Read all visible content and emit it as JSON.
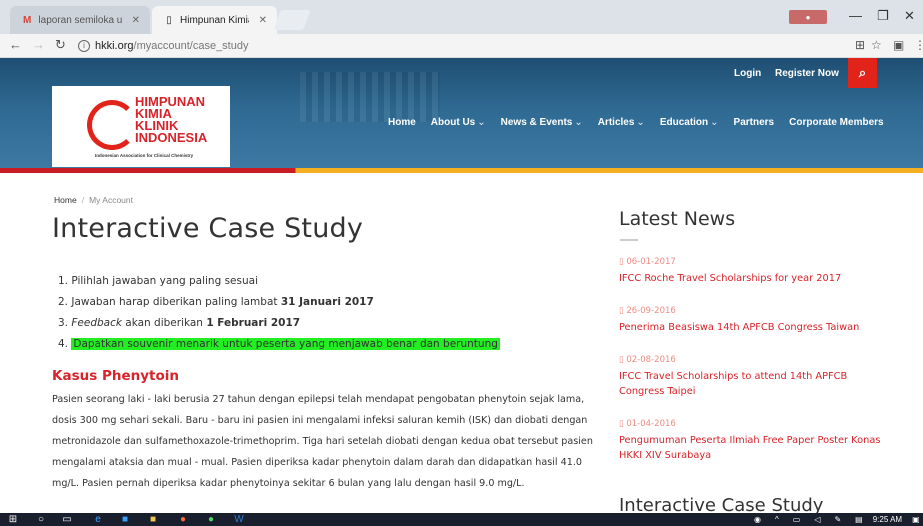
{
  "browser": {
    "tabs": [
      {
        "title": "laporan semiloka unisul",
        "favicon": "M",
        "color": "#d44638"
      },
      {
        "title": "Himpunan Kimia Klinik",
        "favicon": "page-icon"
      }
    ],
    "url": {
      "host": "hkki.org",
      "path": "/myaccount/case_study"
    }
  },
  "site": {
    "logo": {
      "line1": "HIMPUNAN",
      "line2": "KIMIA",
      "line3": "KLINIK",
      "line4": "INDONESIA",
      "tagline": "Indonesian Association for Clinical Chemistry"
    },
    "top_links": {
      "login": "Login",
      "register": "Register Now"
    },
    "nav": [
      {
        "label": "Home",
        "dropdown": false
      },
      {
        "label": "About Us",
        "dropdown": true
      },
      {
        "label": "News & Events",
        "dropdown": true
      },
      {
        "label": "Articles",
        "dropdown": true
      },
      {
        "label": "Education",
        "dropdown": true
      },
      {
        "label": "Partners",
        "dropdown": false
      },
      {
        "label": "Corporate Members",
        "dropdown": false
      }
    ]
  },
  "breadcrumb": {
    "home": "Home",
    "current": "My Account"
  },
  "page": {
    "title": "Interactive Case Study",
    "instructions": {
      "item1": "Pilihlah jawaban yang paling sesuai",
      "item2_text": "Jawaban harap diberikan paling lambat",
      "item2_bold": "31 Januari 2017",
      "item3_italic": "Feedback",
      "item3_text": "akan diberikan",
      "item3_bold": "1 Februari 2017",
      "item4": "Dapatkan souvenir menarik untuk peserta yang menjawab benar dan beruntung"
    },
    "case": {
      "title": "Kasus Phenytoin",
      "body": "Pasien seorang laki - laki berusia 27 tahun dengan epilepsi telah mendapat pengobatan phenytoin sejak lama, dosis 300 mg sehari sekali. Baru - baru ini pasien ini mengalami infeksi saluran kemih (ISK) dan diobati dengan metronidazole dan sulfamethoxazole-trimethoprim. Tiga hari setelah diobati dengan kedua obat tersebut pasien mengalami ataksia dan mual - mual. Pasien diperiksa kadar phenytoin dalam darah dan didapatkan hasil 41.0 mg/L. Pasien pernah diperiksa kadar phenytoinya sekitar 6 bulan yang lalu dengan hasil 9.0 mg/L."
    }
  },
  "sidebar": {
    "latest_title": "Latest News",
    "news": [
      {
        "date": "06-01-2017",
        "title": "IFCC Roche Travel Scholarships for year 2017"
      },
      {
        "date": "26-09-2016",
        "title": "Penerima Beasiswa 14th APFCB Congress Taiwan"
      },
      {
        "date": "02-08-2016",
        "title": "IFCC Travel Scholarships to attend 14th APFCB Congress Taipei"
      },
      {
        "date": "01-04-2016",
        "title": "Pengumuman Peserta Ilmiah Free Paper Poster Konas HKKI XIV Surabaya"
      }
    ],
    "case_title": "Interactive Case Study"
  },
  "taskbar": {
    "time": "9:25 AM"
  },
  "colors": {
    "brand_red": "#d8232a",
    "header_blue": "#2f6a93",
    "highlight": "#22ee22"
  }
}
